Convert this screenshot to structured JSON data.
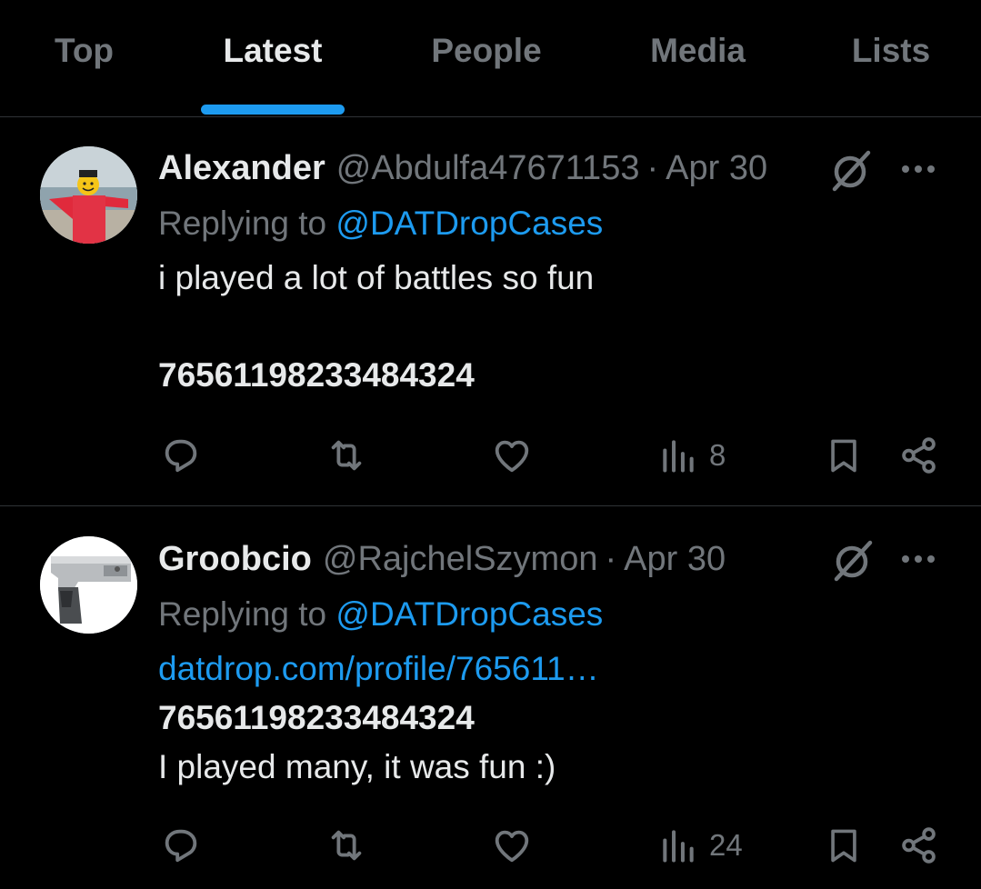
{
  "tabs": [
    {
      "label": "Top",
      "active": false
    },
    {
      "label": "Latest",
      "active": true
    },
    {
      "label": "People",
      "active": false
    },
    {
      "label": "Media",
      "active": false
    },
    {
      "label": "Lists",
      "active": false
    }
  ],
  "tweets": [
    {
      "name": "Alexander",
      "handle": "@Abdulfa47671153",
      "separator": "·",
      "date": "Apr 30",
      "replying_prefix": "Replying to ",
      "replying_to": "@DATDropCases",
      "body_line1": "i played a lot of battles so fun",
      "steam_id": "76561198233484324",
      "views": "8",
      "icons": {
        "reply": "reply-icon",
        "retweet": "retweet-icon",
        "like": "heart-icon",
        "views": "views-icon",
        "bookmark": "bookmark-icon",
        "share": "share-icon",
        "grok": "grok-icon",
        "more": "more-icon"
      }
    },
    {
      "name": "Groobcio",
      "handle": "@RajchelSzymon",
      "separator": "·",
      "date": "Apr 30",
      "replying_prefix": "Replying to ",
      "replying_to": "@DATDropCases",
      "link": "datdrop.com/profile/765611…",
      "steam_id": "76561198233484324",
      "body_line2": "I played many, it was fun :)",
      "views": "24",
      "icons": {
        "reply": "reply-icon",
        "retweet": "retweet-icon",
        "like": "heart-icon",
        "views": "views-icon",
        "bookmark": "bookmark-icon",
        "share": "share-icon",
        "grok": "grok-icon",
        "more": "more-icon"
      }
    }
  ],
  "colors": {
    "accent": "#1d9bf0",
    "muted": "#71767b",
    "text": "#e7e9ea",
    "background": "#000000",
    "divider": "#2f3336"
  }
}
